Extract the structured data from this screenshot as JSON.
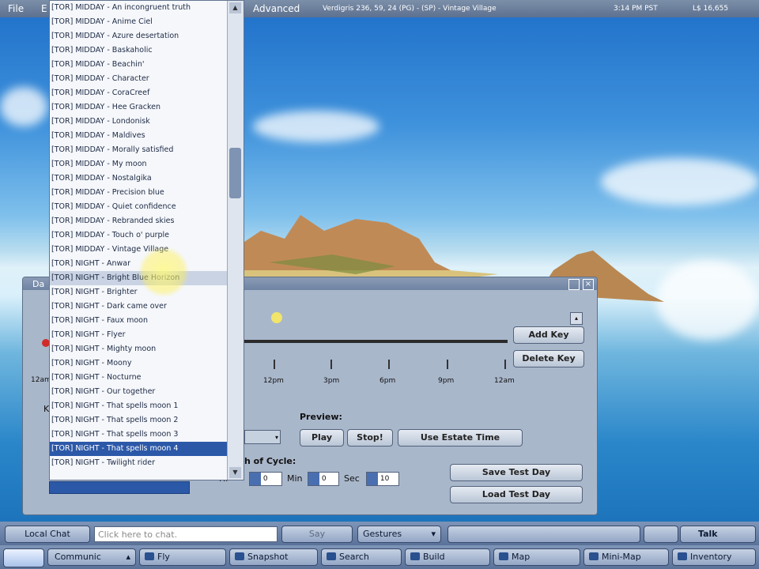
{
  "menubar": {
    "file": "File",
    "edit": "E",
    "advanced": "Advanced",
    "location": "Verdigris 236, 59, 24 (PG) - (SP) - Vintage Village",
    "time": "3:14 PM PST",
    "balance": "L$ 16,655"
  },
  "day_cycle": {
    "title": "Da",
    "add_key": "Add Key",
    "delete_key": "Delete Key",
    "time_labels": [
      "12pm",
      "3pm",
      "6pm",
      "9pm",
      "12am"
    ],
    "left_time_label": "12am",
    "preview_label": "Preview:",
    "play": "Play",
    "stop": "Stop!",
    "use_estate_time": "Use Estate Time",
    "cycle_label": "h of Cycle:",
    "hr_label": "Hr",
    "min_label": "Min",
    "sec_label": "Sec",
    "hr_value": "0",
    "min_value": "0",
    "sec_value": "10",
    "save_test_day": "Save Test Day",
    "load_test_day": "Load Test Day",
    "k_label": "K"
  },
  "presets": [
    "[TOR] MIDDAY - An incongruent truth",
    "[TOR] MIDDAY - Anime Ciel",
    "[TOR] MIDDAY - Azure desertation",
    "[TOR] MIDDAY - Baskaholic",
    "[TOR] MIDDAY - Beachin'",
    "[TOR] MIDDAY - Character",
    "[TOR] MIDDAY - CoraCreef",
    "[TOR] MIDDAY - Hee Gracken",
    "[TOR] MIDDAY - Londonisk",
    "[TOR] MIDDAY - Maldives",
    "[TOR] MIDDAY - Morally satisfied",
    "[TOR] MIDDAY - My moon",
    "[TOR] MIDDAY - Nostalgika",
    "[TOR] MIDDAY - Precision blue",
    "[TOR] MIDDAY - Quiet confidence",
    "[TOR] MIDDAY - Rebranded skies",
    "[TOR] MIDDAY - Touch o' purple",
    "[TOR] MIDDAY - Vintage Village",
    "[TOR] NIGHT - Anwar",
    "[TOR] NIGHT - Bright Blue Horizon",
    "[TOR] NIGHT - Brighter",
    "[TOR] NIGHT - Dark came over",
    "[TOR] NIGHT - Faux moon",
    "[TOR] NIGHT - Flyer",
    "[TOR] NIGHT - Mighty moon",
    "[TOR] NIGHT - Moony",
    "[TOR] NIGHT - Nocturne",
    "[TOR] NIGHT - Our together",
    "[TOR] NIGHT - That spells moon 1",
    "[TOR] NIGHT - That spells moon 2",
    "[TOR] NIGHT - That spells moon 3",
    "[TOR] NIGHT - That spells moon 4",
    "[TOR] NIGHT - Twilight rider"
  ],
  "bottom": {
    "local_chat": "Local Chat",
    "chat_placeholder": "Click here to chat.",
    "say": "Say",
    "gestures": "Gestures",
    "talk": "Talk",
    "communicate": "Communic",
    "fly": "Fly",
    "snapshot": "Snapshot",
    "search": "Search",
    "build": "Build",
    "map": "Map",
    "minimap": "Mini-Map",
    "inventory": "Inventory"
  },
  "colors": {
    "accent": "#2c58a8",
    "hover": "#c9d3e3"
  }
}
